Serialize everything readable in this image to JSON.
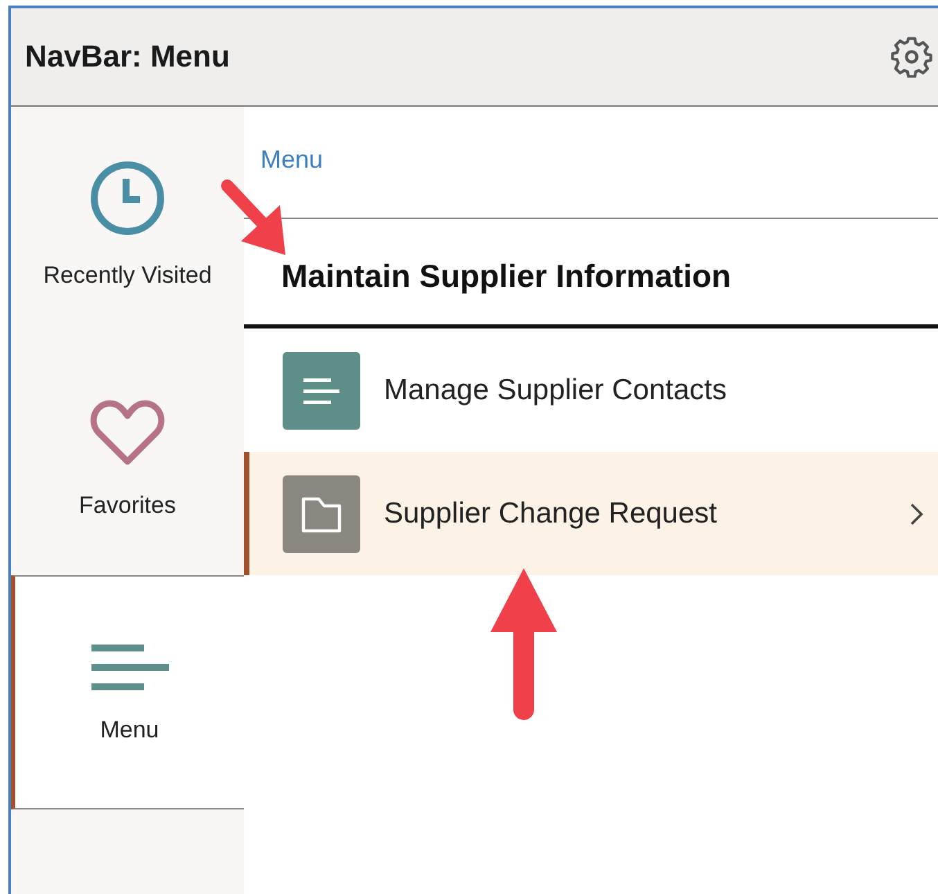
{
  "header": {
    "title": "NavBar: Menu"
  },
  "sidebar": {
    "items": [
      {
        "label": "Recently Visited",
        "kind": "clock",
        "selected": false
      },
      {
        "label": "Favorites",
        "kind": "heart",
        "selected": false
      },
      {
        "label": "Menu",
        "kind": "lines",
        "selected": true
      }
    ]
  },
  "breadcrumb": "Menu",
  "section": {
    "heading": "Maintain Supplier Information"
  },
  "rows": [
    {
      "label": "Manage Supplier Contacts",
      "kind": "list",
      "selected": false,
      "expandable": false
    },
    {
      "label": "Supplier Change Request",
      "kind": "folder",
      "selected": true,
      "expandable": true
    }
  ]
}
